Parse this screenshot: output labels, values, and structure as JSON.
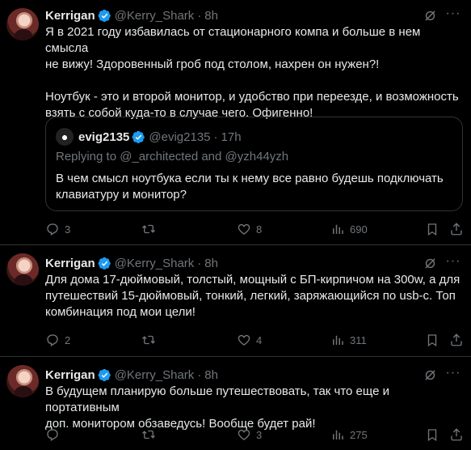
{
  "tweets": [
    {
      "name": "Kerrigan",
      "handle": "@Kerry_Shark",
      "dot": "·",
      "time": "8h",
      "text": "Я в 2021 году избавилась от стационарного компа и больше в нем смысла\nне вижу! Здоровенный гроб под столом, нахрен он нужен?!\n\nНоутбук - это и второй монитор, и удобство при переезде, и возможность\nвзять с собой куда-то в случае чего. Офигенно!",
      "quote": {
        "name": "evig2135",
        "handle": "@evig2135",
        "dot": "·",
        "time": "17h",
        "replying_prefix": "Replying to",
        "replying_to_1": "@_architected",
        "replying_and": "and",
        "replying_to_2": "@yzh44yzh",
        "text": "В чем смысл ноутбука если ты к нему все равно будешь подключать\nклавиатуру и монитор?"
      },
      "replies": "3",
      "retweets": "",
      "likes": "8",
      "views": "690"
    },
    {
      "name": "Kerrigan",
      "handle": "@Kerry_Shark",
      "dot": "·",
      "time": "8h",
      "text": "Для дома 17-дюймовый, толстый, мощный с БП-кирпичом на 300w, а для\nпутешествий 15-дюймовый, тонкий, легкий, заряжающийся по usb-c. Топ\nкомбинация под мои цели!",
      "replies": "2",
      "retweets": "",
      "likes": "4",
      "views": "311"
    },
    {
      "name": "Kerrigan",
      "handle": "@Kerry_Shark",
      "dot": "·",
      "time": "8h",
      "text": "В будущем планирую больше путешествовать, так что еще и портативным\nдоп. монитором обзаведусь! Вообще будет рай!",
      "replies": "",
      "retweets": "",
      "likes": "3",
      "views": "275"
    }
  ],
  "colors": {
    "background": "#000000",
    "text": "#e7e9ea",
    "muted": "#71767b",
    "verified": "#1d9bf0",
    "border": "#2f3336"
  },
  "icons": [
    "verified-badge-icon",
    "grok-icon",
    "more-icon",
    "reply-icon",
    "retweet-icon",
    "like-icon",
    "views-icon",
    "bookmark-icon",
    "share-icon"
  ]
}
